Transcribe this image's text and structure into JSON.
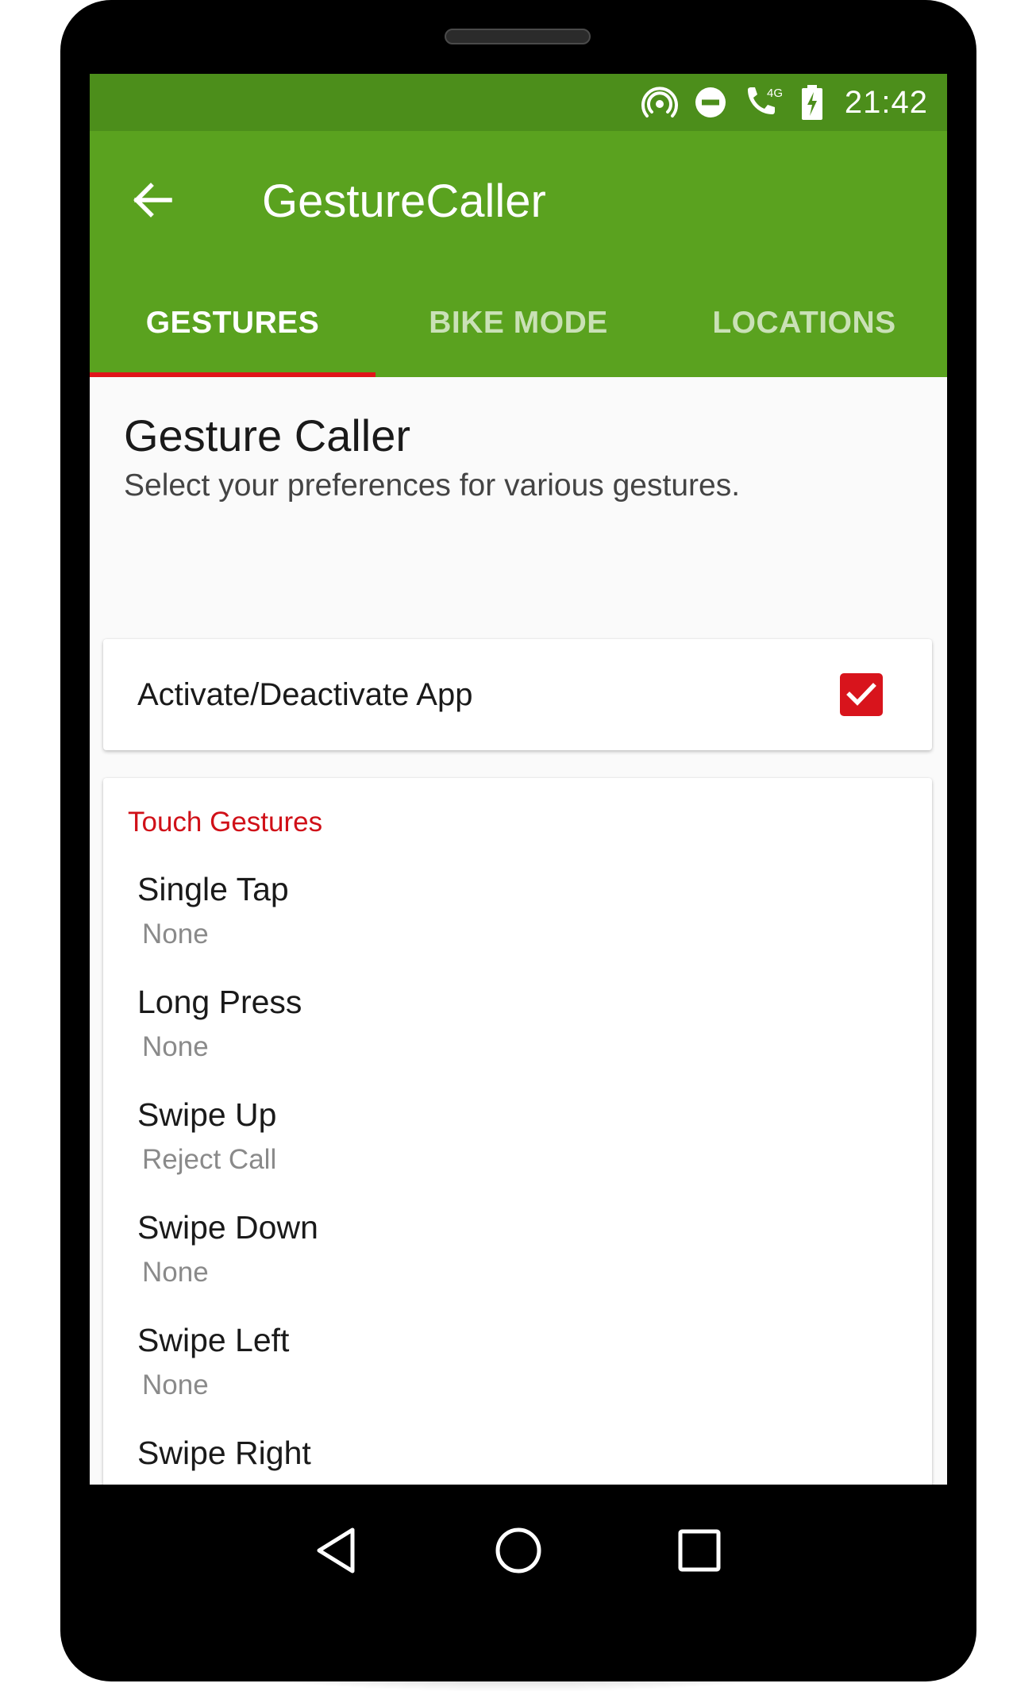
{
  "status_bar": {
    "time": "21:42",
    "network_label": "4G",
    "icons": [
      "hotspot-icon",
      "do-not-disturb-icon",
      "wifi-calling-icon",
      "battery-charging-icon"
    ]
  },
  "app_bar": {
    "title": "GestureCaller",
    "back_icon": "arrow-back-icon"
  },
  "tabs": [
    {
      "label": "GESTURES",
      "active": true
    },
    {
      "label": "BIKE MODE",
      "active": false
    },
    {
      "label": "LOCATIONS",
      "active": false
    }
  ],
  "header": {
    "title": "Gesture Caller",
    "subtitle": "Select your preferences for various gestures."
  },
  "activate": {
    "label": "Activate/Deactivate App",
    "checked": true
  },
  "touch_gestures": {
    "category": "Touch Gestures",
    "items": [
      {
        "title": "Single Tap",
        "summary": "None"
      },
      {
        "title": "Long Press",
        "summary": "None"
      },
      {
        "title": "Swipe Up",
        "summary": "Reject Call"
      },
      {
        "title": "Swipe Down",
        "summary": "None"
      },
      {
        "title": "Swipe Left",
        "summary": "None"
      },
      {
        "title": "Swipe Right",
        "summary": ""
      }
    ]
  },
  "nav_bar": {
    "icons": [
      "back-triangle-icon",
      "home-circle-icon",
      "recents-square-icon"
    ]
  },
  "colors": {
    "status_bar": "#4c8e1b",
    "app_bar": "#5aa21f",
    "accent": "#d8141c"
  }
}
